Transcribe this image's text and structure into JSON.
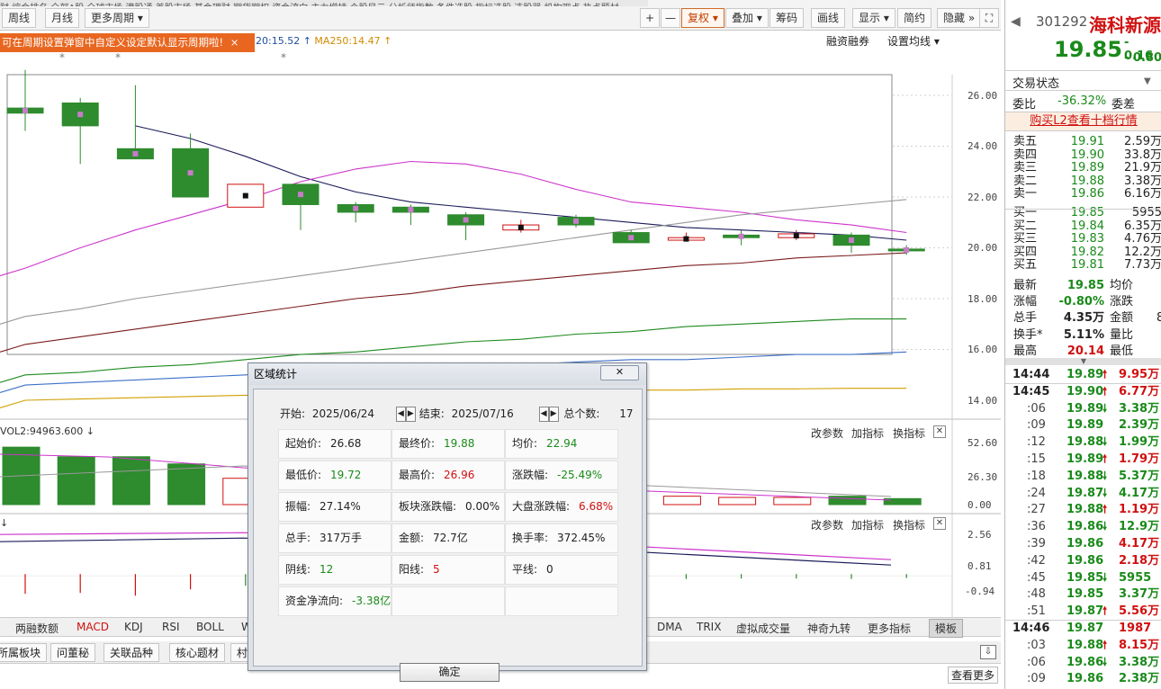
{
  "toolbar": {
    "top_strip_text": "财 综合排名 全部A股 全球市场 港股通 美股市场 基金理财 期货期权 资金流向 主力增持 个股风云 分析师指数 条件选股 指标选股 选股器 机构观点 热点题材",
    "period_buttons": [
      "周线",
      "月线",
      "更多周期"
    ],
    "right_buttons": [
      "+",
      "—",
      "复权",
      "叠加",
      "筹码",
      "画线",
      "显示",
      "简约",
      "隐藏"
    ],
    "more_period_caret": "▾",
    "fullscreen_icon": "expand-icon"
  },
  "tip": {
    "text": "可在周期设置弹窗中自定义设定默认显示周期啦!",
    "close": "×"
  },
  "ma_legend": [
    {
      "text": "20:15.52",
      "color": "#1f4fa0"
    },
    {
      "text": "MA250:14.47",
      "color": "#d08a00"
    }
  ],
  "chart_links": {
    "margin": "融资融券",
    "set_ma": "设置均线"
  },
  "price_axis": [
    "26.00",
    "24.00",
    "22.00",
    "20.00",
    "18.00",
    "16.00",
    "14.00"
  ],
  "vol_panel": {
    "label": "VOL2:94963.600",
    "axis": [
      "52.60",
      "26.30",
      "0.00"
    ],
    "buttons": [
      "改参数",
      "加指标",
      "换指标"
    ]
  },
  "macd_panel": {
    "axis": [
      "2.56",
      "0.81",
      "-0.94"
    ],
    "buttons": [
      "改参数",
      "加指标",
      "换指标"
    ]
  },
  "indicator_tabs": [
    "两融数额",
    "MACD",
    "KDJ",
    "RSI",
    "BOLL",
    "W",
    "DMA",
    "TRIX",
    "虚拟成交量",
    "神奇九转",
    "更多指标",
    "模板"
  ],
  "bottom_tabs": [
    "所属板块",
    "问董秘",
    "关联品种",
    "核心题材",
    "村"
  ],
  "bottom_link": "查看更多",
  "dialog": {
    "title": "区域统计",
    "close_label": "✕",
    "start_label": "开始:",
    "start_date": "2025/06/24",
    "end_label": "结束:",
    "end_date": "2025/07/16",
    "count_label": "总个数:",
    "count": "17",
    "rows": [
      [
        {
          "label": "起始价:",
          "value": "26.68",
          "color": ""
        },
        {
          "label": "最终价:",
          "value": "19.88",
          "color": "green"
        },
        {
          "label": "均价:",
          "value": "22.94",
          "color": "green"
        }
      ],
      [
        {
          "label": "最低价:",
          "value": "19.72",
          "color": "green"
        },
        {
          "label": "最高价:",
          "value": "26.96",
          "color": "red"
        },
        {
          "label": "涨跌幅:",
          "value": "-25.49%",
          "color": "green"
        }
      ],
      [
        {
          "label": "振幅:",
          "value": "27.14%",
          "color": ""
        },
        {
          "label": "板块涨跌幅:",
          "value": "0.00%",
          "color": ""
        },
        {
          "label": "大盘涨跌幅:",
          "value": "6.68%",
          "color": "red"
        }
      ],
      [
        {
          "label": "总手:",
          "value": "317万手",
          "color": ""
        },
        {
          "label": "金额:",
          "value": "72.7亿",
          "color": ""
        },
        {
          "label": "换手率:",
          "value": "372.45%",
          "color": ""
        }
      ],
      [
        {
          "label": "阴线:",
          "value": "12",
          "color": "green"
        },
        {
          "label": "阳线:",
          "value": "5",
          "color": "red"
        },
        {
          "label": "平线:",
          "value": "0",
          "color": ""
        }
      ],
      [
        {
          "label": "资金净流向:",
          "value": "-3.38亿",
          "color": "green"
        },
        {
          "label": "",
          "value": "",
          "color": ""
        },
        {
          "label": "",
          "value": "",
          "color": ""
        }
      ]
    ],
    "ok": "确定"
  },
  "quote": {
    "code": "301292",
    "name": "海科新源",
    "price": "19.85",
    "change": "- 0.16",
    "change_pct": "- 0.80%",
    "status_label": "交易状态",
    "ratio_label": "委比",
    "ratio_value": "-36.32%",
    "diff_label": "委差",
    "l2_link": "购买L2查看十档行情",
    "asks": [
      {
        "label": "卖五",
        "price": "19.91",
        "vol": "2.59万"
      },
      {
        "label": "卖四",
        "price": "19.90",
        "vol": "33.8万"
      },
      {
        "label": "卖三",
        "price": "19.89",
        "vol": "21.9万"
      },
      {
        "label": "卖二",
        "price": "19.88",
        "vol": "3.38万"
      },
      {
        "label": "卖一",
        "price": "19.86",
        "vol": "6.16万"
      }
    ],
    "bids": [
      {
        "label": "买一",
        "price": "19.85",
        "vol": "5955"
      },
      {
        "label": "买二",
        "price": "19.84",
        "vol": "6.35万"
      },
      {
        "label": "买三",
        "price": "19.83",
        "vol": "4.76万"
      },
      {
        "label": "买四",
        "price": "19.82",
        "vol": "12.2万"
      },
      {
        "label": "买五",
        "price": "19.81",
        "vol": "7.73万"
      }
    ],
    "stats": [
      {
        "l1": "最新",
        "v1": "19.85",
        "c1": "green",
        "l2": "均价",
        "v2": ""
      },
      {
        "l1": "涨幅",
        "v1": "-0.80%",
        "c1": "green",
        "l2": "涨跌",
        "v2": ""
      },
      {
        "l1": "总手",
        "v1": "4.35万",
        "c1": "",
        "l2": "金额",
        "v2": "8"
      },
      {
        "l1": "换手*",
        "v1": "5.11%",
        "c1": "",
        "l2": "量比",
        "v2": ""
      },
      {
        "l1": "最高",
        "v1": "20.14",
        "c1": "red",
        "l2": "最低",
        "v2": ""
      }
    ],
    "ticks": [
      {
        "time": "14:44",
        "price": "19.89",
        "dir": "up",
        "vol": "9.95万",
        "vc": "red",
        "pc": "green"
      },
      {
        "time": "14:45",
        "price": "19.90",
        "dir": "up",
        "vol": "6.77万",
        "vc": "red",
        "pc": "green"
      },
      {
        "time": ":06",
        "price": "19.89",
        "dir": "down",
        "vol": "3.38万",
        "vc": "green",
        "pc": "green"
      },
      {
        "time": ":09",
        "price": "19.89",
        "dir": "",
        "vol": "2.39万",
        "vc": "green",
        "pc": "green"
      },
      {
        "time": ":12",
        "price": "19.88",
        "dir": "down",
        "vol": "1.99万",
        "vc": "green",
        "pc": "green"
      },
      {
        "time": ":15",
        "price": "19.89",
        "dir": "up",
        "vol": "1.79万",
        "vc": "red",
        "pc": "green"
      },
      {
        "time": ":18",
        "price": "19.88",
        "dir": "down",
        "vol": "5.37万",
        "vc": "green",
        "pc": "green"
      },
      {
        "time": ":24",
        "price": "19.87",
        "dir": "down",
        "vol": "4.17万",
        "vc": "green",
        "pc": "green"
      },
      {
        "time": ":27",
        "price": "19.88",
        "dir": "up",
        "vol": "1.19万",
        "vc": "red",
        "pc": "green"
      },
      {
        "time": ":36",
        "price": "19.86",
        "dir": "down",
        "vol": "12.9万",
        "vc": "green",
        "pc": "green"
      },
      {
        "time": ":39",
        "price": "19.86",
        "dir": "",
        "vol": "4.17万",
        "vc": "red",
        "pc": "green"
      },
      {
        "time": ":42",
        "price": "19.86",
        "dir": "",
        "vol": "2.18万",
        "vc": "red",
        "pc": "green"
      },
      {
        "time": ":45",
        "price": "19.85",
        "dir": "down",
        "vol": "5955",
        "vc": "green",
        "pc": "green"
      },
      {
        "time": ":48",
        "price": "19.85",
        "dir": "",
        "vol": "3.37万",
        "vc": "green",
        "pc": "green"
      },
      {
        "time": ":51",
        "price": "19.87",
        "dir": "up",
        "vol": "5.56万",
        "vc": "red",
        "pc": "green"
      },
      {
        "time": "14:46",
        "price": "19.87",
        "dir": "",
        "vol": "1987",
        "vc": "red",
        "pc": "green"
      },
      {
        "time": ":03",
        "price": "19.88",
        "dir": "up",
        "vol": "8.15万",
        "vc": "red",
        "pc": "green"
      },
      {
        "time": ":06",
        "price": "19.86",
        "dir": "down",
        "vol": "3.38万",
        "vc": "green",
        "pc": "green"
      },
      {
        "time": ":09",
        "price": "19.86",
        "dir": "",
        "vol": "2.38万",
        "vc": "green",
        "pc": "green"
      }
    ]
  },
  "chart_data": {
    "type": "candlestick",
    "ylim": [
      14,
      27
    ],
    "candles": [
      {
        "o": 25.5,
        "c": 25.3,
        "h": 27.0,
        "l": 24.6
      },
      {
        "o": 25.7,
        "c": 24.8,
        "h": 25.9,
        "l": 23.3
      },
      {
        "o": 23.9,
        "c": 23.5,
        "h": 26.4,
        "l": 23.5
      },
      {
        "o": 23.9,
        "c": 22.0,
        "h": 24.5,
        "l": 22.0
      },
      {
        "o": 21.6,
        "c": 22.5,
        "h": 22.5,
        "l": 21.6
      },
      {
        "o": 22.5,
        "c": 21.7,
        "h": 22.5,
        "l": 20.7
      },
      {
        "o": 21.7,
        "c": 21.4,
        "h": 21.8,
        "l": 21.0
      },
      {
        "o": 21.6,
        "c": 21.4,
        "h": 21.7,
        "l": 20.9
      },
      {
        "o": 21.3,
        "c": 20.9,
        "h": 21.4,
        "l": 20.3
      },
      {
        "o": 20.7,
        "c": 20.9,
        "h": 21.1,
        "l": 20.6
      },
      {
        "o": 21.2,
        "c": 20.9,
        "h": 21.3,
        "l": 20.8
      },
      {
        "o": 20.6,
        "c": 20.2,
        "h": 20.7,
        "l": 20.2
      },
      {
        "o": 20.3,
        "c": 20.4,
        "h": 20.6,
        "l": 20.3
      },
      {
        "o": 20.5,
        "c": 20.4,
        "h": 20.7,
        "l": 20.1
      },
      {
        "o": 20.4,
        "c": 20.55,
        "h": 20.7,
        "l": 20.3
      },
      {
        "o": 20.5,
        "c": 20.1,
        "h": 20.6,
        "l": 19.8
      },
      {
        "o": 19.95,
        "c": 19.88,
        "h": 20.1,
        "l": 19.72
      }
    ],
    "volume": [
      {
        "v": 48,
        "up": false
      },
      {
        "v": 40,
        "up": false
      },
      {
        "v": 40,
        "up": false
      },
      {
        "v": 34,
        "up": false
      },
      {
        "v": 22,
        "up": true
      },
      {
        "v": 20,
        "up": false
      },
      {
        "v": 14,
        "up": false
      },
      {
        "v": 12,
        "up": false
      },
      {
        "v": 10,
        "up": false
      },
      {
        "v": 8,
        "up": true
      },
      {
        "v": 8,
        "up": true
      },
      {
        "v": 9,
        "up": false
      },
      {
        "v": 7,
        "up": true
      },
      {
        "v": 6,
        "up": true
      },
      {
        "v": 6,
        "up": true
      },
      {
        "v": 7,
        "up": false
      },
      {
        "v": 5,
        "up": false
      }
    ],
    "series": [
      {
        "name": "MA5",
        "color": "#1a1a5a",
        "values": [
          null,
          null,
          24.8,
          24.3,
          23.6,
          22.8,
          22.2,
          21.8,
          21.6,
          21.4,
          21.2,
          21.0,
          20.8,
          20.7,
          20.6,
          20.5,
          20.3
        ]
      },
      {
        "name": "MA10",
        "color": "#cc33cc",
        "values": [
          19.2,
          20.0,
          20.7,
          21.3,
          21.9,
          22.6,
          23.1,
          23.4,
          23.3,
          22.9,
          22.3,
          21.8,
          21.6,
          21.4,
          21.1,
          20.9,
          20.6
        ]
      },
      {
        "name": "MA20",
        "color": "#999999",
        "values": [
          17.3,
          17.6,
          18.0,
          18.3,
          18.6,
          18.9,
          19.2,
          19.5,
          19.8,
          20.1,
          20.4,
          20.7,
          21.0,
          21.3,
          21.5,
          21.7,
          21.9
        ]
      },
      {
        "name": "MA60",
        "color": "#7a1a1a",
        "values": [
          16.2,
          16.5,
          16.8,
          17.1,
          17.4,
          17.7,
          18.0,
          18.2,
          18.5,
          18.7,
          18.9,
          19.1,
          19.3,
          19.4,
          19.6,
          19.7,
          19.8
        ]
      },
      {
        "name": "MA120",
        "color": "#1f8a1f",
        "values": [
          15.0,
          15.1,
          15.3,
          15.4,
          15.6,
          15.8,
          15.9,
          16.1,
          16.3,
          16.4,
          16.6,
          16.7,
          16.9,
          17.0,
          17.1,
          17.2,
          17.2
        ]
      },
      {
        "name": "MA180",
        "color": "#3c6fc9",
        "values": [
          14.6,
          14.7,
          14.8,
          14.9,
          15.0,
          15.1,
          15.1,
          15.2,
          15.3,
          15.4,
          15.5,
          15.6,
          15.6,
          15.7,
          15.8,
          15.8,
          15.9
        ]
      },
      {
        "name": "MA250",
        "color": "#d0a000",
        "values": [
          14.0,
          14.05,
          14.1,
          14.15,
          14.2,
          14.2,
          14.25,
          14.3,
          14.3,
          14.35,
          14.35,
          14.4,
          14.4,
          14.45,
          14.45,
          14.47,
          14.47
        ]
      }
    ]
  }
}
